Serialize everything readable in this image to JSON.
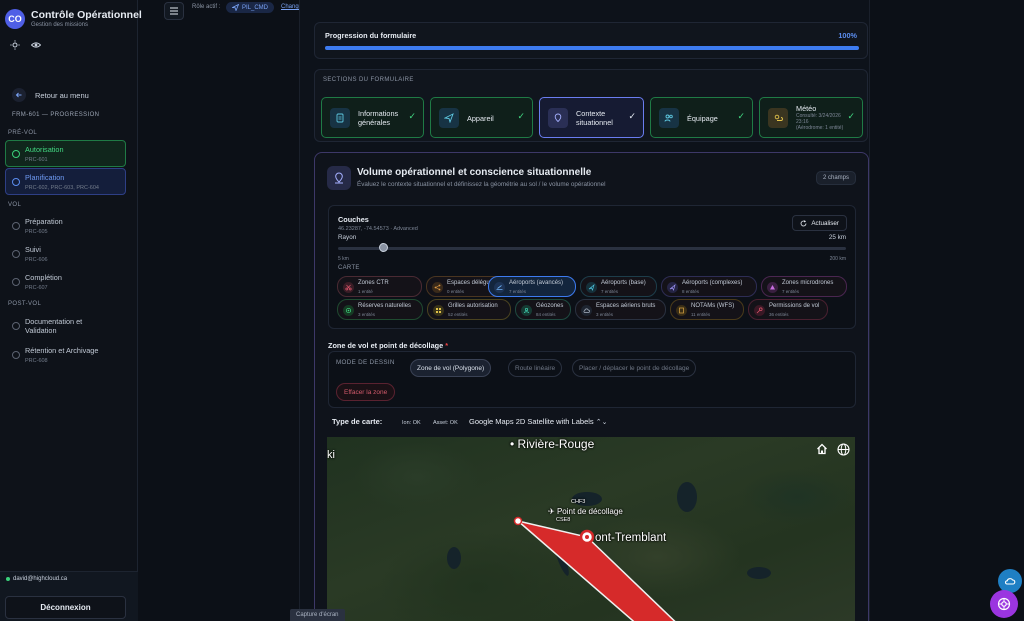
{
  "app": {
    "logo": "CO",
    "title": "Contrôle Opérationnel",
    "subtitle": "Gestion des missions"
  },
  "sidebar": {
    "back": "Retour au menu",
    "progress_title": "FRM-601 — PROGRESSION",
    "sections": {
      "pre": "PRÉ-VOL",
      "vol": "VOL",
      "post": "POST-VOL"
    },
    "items": [
      {
        "label": "Autorisation",
        "code": "PRC-601",
        "status": "done"
      },
      {
        "label": "Planification",
        "code": "PRC-602, PRC-603, PRC-604",
        "status": "active"
      },
      {
        "label": "Préparation",
        "code": "PRC-605",
        "status": "todo"
      },
      {
        "label": "Suivi",
        "code": "PRC-606",
        "status": "todo"
      },
      {
        "label": "Complétion",
        "code": "PRC-607",
        "status": "todo"
      },
      {
        "label": "Documentation et",
        "label2": "Validation",
        "status": "todo"
      },
      {
        "label": "Rétention et Archivage",
        "code": "PRC-608",
        "status": "todo"
      }
    ],
    "user_email": "david@highcloud.ca",
    "logout": "Déconnexion"
  },
  "topbar": {
    "role_label": "Rôle actif :",
    "role": "PIL_CMD",
    "change": "Changer"
  },
  "progress": {
    "label": "Progression du formulaire",
    "value_text": "100%",
    "value": 1.0
  },
  "sections": {
    "title": "SECTIONS DU FORMULAIRE",
    "items": [
      {
        "l1": "Informations",
        "l2": "générales"
      },
      {
        "l1": "Appareil"
      },
      {
        "l1": "Contexte",
        "l2": "situationnel"
      },
      {
        "l1": "Équipage"
      },
      {
        "l1": "Météo",
        "sub1": "Consulté: 3/24/2026",
        "sub2": "23:16",
        "sub3": "(Aérodrome: 1 entité)"
      }
    ]
  },
  "card": {
    "title": "Volume opérationnel et conscience situationnelle",
    "desc": "Évaluez le contexte situationnel et définissez la géométrie au sol / le volume opérationnel",
    "count": "2 champs",
    "layers": {
      "title": "Couches",
      "coords": "46.23287, -74.54573 · Advanced",
      "update": "Actualiser",
      "radius_label": "Rayon",
      "radius_value": "25 km",
      "radius_fraction": 0.09,
      "min": "5 km",
      "max": "200 km",
      "carte": "CARTE",
      "chips": [
        {
          "name": "Zones CTR",
          "ent": "1 entité"
        },
        {
          "name": "Espaces délégués",
          "ent": "0 entités"
        },
        {
          "name": "Aéroports (avancés)",
          "ent": "7 entités"
        },
        {
          "name": "Aéroports (base)",
          "ent": "7 entités"
        },
        {
          "name": "Aéroports (complexes)",
          "ent": "8 entités"
        },
        {
          "name": "Zones microdrones",
          "ent": "7 entités"
        },
        {
          "name": "Réserves naturelles",
          "ent": "3 entités"
        },
        {
          "name": "Grilles autorisation",
          "ent": "52 entités"
        },
        {
          "name": "Géozones",
          "ent": "84 entités"
        },
        {
          "name": "Espaces aériens bruts",
          "ent": "3 entités"
        },
        {
          "name": "NOTAMs (WFS)",
          "ent": "11 entités"
        },
        {
          "name": "Permissions de vol",
          "ent": "36 entités"
        }
      ]
    },
    "zone": {
      "label": "Zone de vol et point de décollage",
      "required": "*",
      "mode_label": "MODE DE DESSIN",
      "buttons": [
        "Zone de vol (Polygone)",
        "Route linéaire",
        "Placer / déplacer le point de décollage"
      ],
      "clear": "Effacer la zone"
    },
    "map": {
      "type_label": "Type de carte:",
      "ion": "Ion: OK",
      "asset": "Asset: OK",
      "selected": "Google Maps 2D Satellite with Labels",
      "labels": {
        "city1": "Rivière-Rouge",
        "city2": "ont-Tremblant",
        "left": "ki",
        "marker": "Point de décollage",
        "code1": "CHF3",
        "code2": "CSE8"
      }
    }
  },
  "footer": {
    "screenshot": "Capture d'écran"
  },
  "colors": {
    "accent": "#3d7bf0",
    "success": "#42d982",
    "danger": "#e0322f",
    "purple": "#9b35e0"
  }
}
